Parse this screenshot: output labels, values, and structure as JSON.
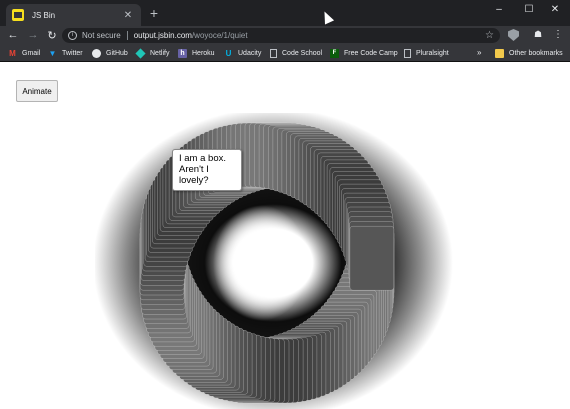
{
  "tab": {
    "title": "JS Bin",
    "close_glyph": "✕"
  },
  "new_tab_glyph": "+",
  "window_controls": {
    "minimize": "–",
    "maximize": "☐",
    "close": "✕"
  },
  "toolbar": {
    "back_glyph": "←",
    "forward_glyph": "→",
    "reload_glyph": "↻",
    "security_label": "Not secure",
    "url_host": "output.jsbin.com",
    "url_path": "/woyoce/1/quiet",
    "star_glyph": "☆",
    "menu_glyph": "⋮"
  },
  "bookmarks": {
    "items": [
      {
        "label": "Gmail",
        "icon": "gmail-icon"
      },
      {
        "label": "Twitter",
        "icon": "twitter-icon"
      },
      {
        "label": "GitHub",
        "icon": "github-icon"
      },
      {
        "label": "Netlify",
        "icon": "netlify-icon"
      },
      {
        "label": "Heroku",
        "icon": "heroku-icon"
      },
      {
        "label": "Udacity",
        "icon": "udacity-icon"
      },
      {
        "label": "Code School",
        "icon": "page-icon"
      },
      {
        "label": "Free Code Camp",
        "icon": "freecodecamp-icon"
      },
      {
        "label": "Pluralsight",
        "icon": "page-icon"
      }
    ],
    "overflow_glyph": "»",
    "other_label": "Other bookmarks"
  },
  "page": {
    "animate_label": "Animate",
    "box_text": "I am a box. Aren't I lovely?"
  }
}
